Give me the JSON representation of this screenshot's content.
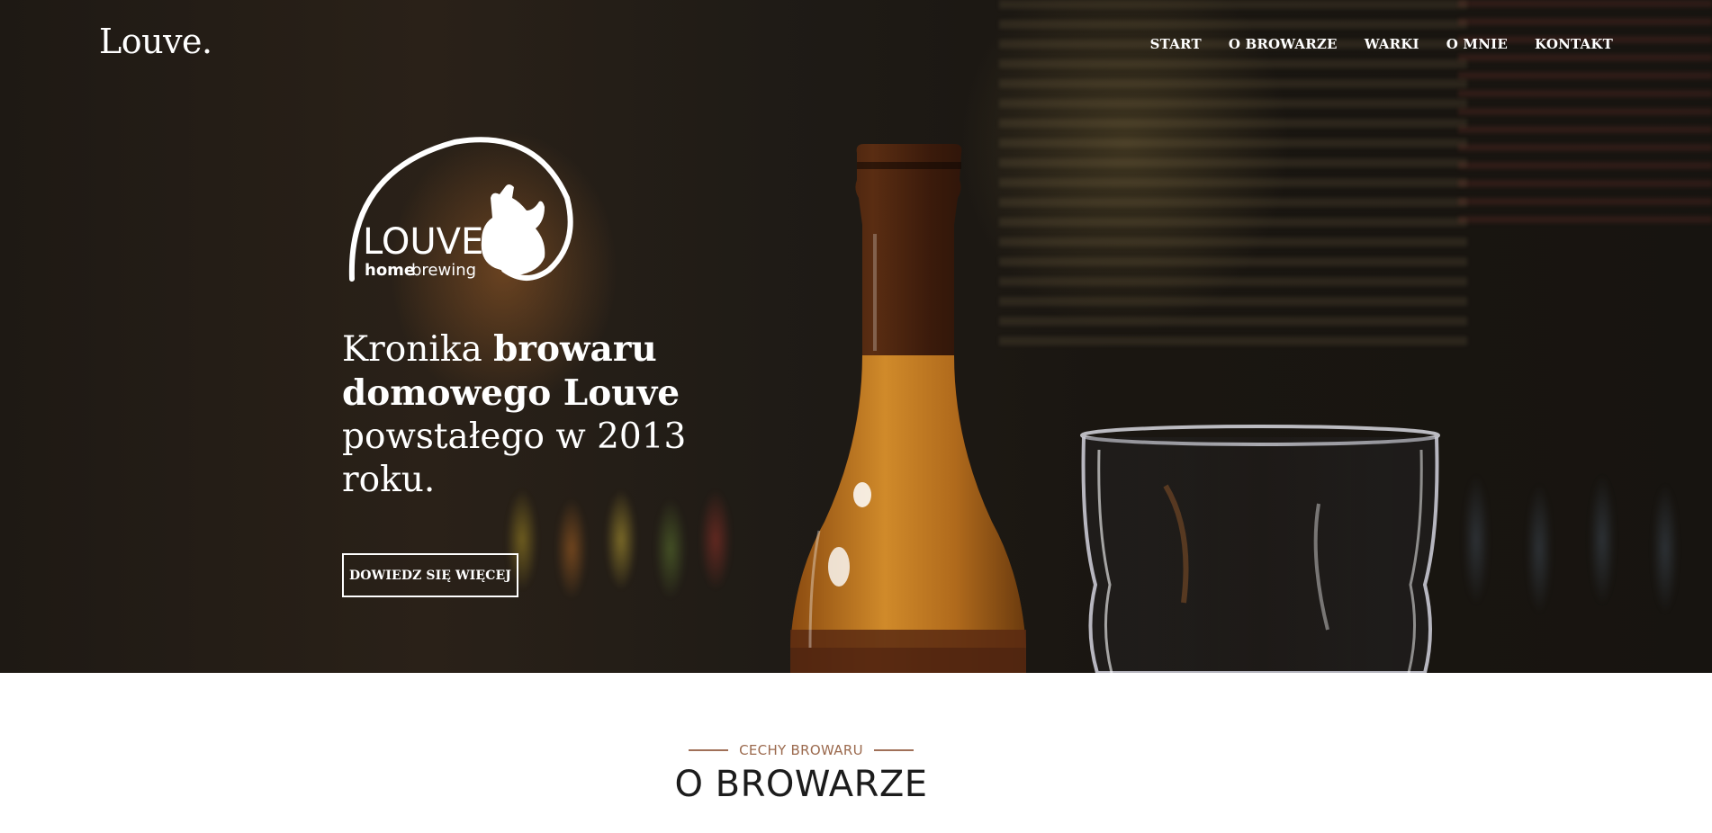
{
  "header": {
    "brand": "Louve.",
    "nav": [
      "START",
      "O BROWARZE",
      "WARKI",
      "O MNIE",
      "KONTAKT"
    ]
  },
  "hero": {
    "logo": {
      "word": "LOUVE",
      "sub_bold": "home",
      "sub_light": "brewing"
    },
    "tagline": {
      "part1": "Kronika ",
      "bold": "browaru domowego Louve",
      "part2": " powstałego w 2013 roku."
    },
    "cta_label": "DOWIEDZ SIĘ WIĘCEJ"
  },
  "section": {
    "eyebrow": "CECHY BROWARU",
    "title": "O BROWARZE",
    "accent_color": "#a07058"
  }
}
